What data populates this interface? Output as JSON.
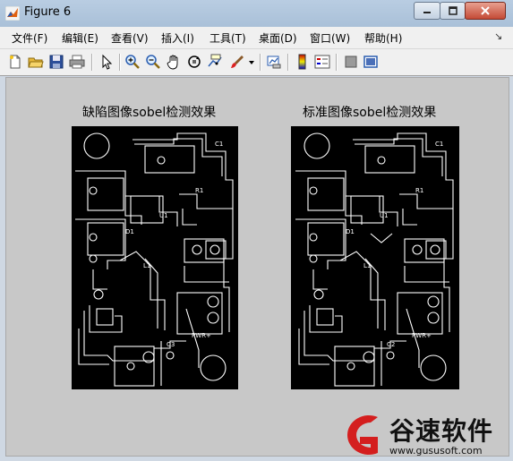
{
  "window": {
    "title": "Figure 6"
  },
  "menu": [
    {
      "label": "文件(F)"
    },
    {
      "label": "编辑(E)"
    },
    {
      "label": "查看(V)"
    },
    {
      "label": "插入(I)"
    },
    {
      "label": "工具(T)"
    },
    {
      "label": "桌面(D)"
    },
    {
      "label": "窗口(W)"
    },
    {
      "label": "帮助(H)"
    }
  ],
  "toolbar": [
    "new-file-icon",
    "open-folder-icon",
    "save-icon",
    "print-icon",
    "select-arrow-icon",
    "zoom-in-icon",
    "zoom-out-icon",
    "pan-hand-icon",
    "rotate-3d-icon",
    "data-cursor-icon",
    "brush-icon",
    "dropdown-icon",
    "link-plot-icon",
    "colorbar-icon",
    "legend-icon",
    "hide-plot-tools-icon",
    "show-plot-tools-icon"
  ],
  "axes": [
    {
      "title": "缺陷图像sobel检测效果"
    },
    {
      "title": "标准图像sobel检测效果"
    }
  ],
  "pcb_labels": {
    "c1": "C1",
    "c2": "C2",
    "r1": "R1",
    "u1": "U1",
    "l1": "L1",
    "d1": "D1",
    "pwr": "PWR+",
    "c3": "C3"
  },
  "watermark": {
    "name": "谷速软件",
    "url": "www.gususoft.com"
  }
}
